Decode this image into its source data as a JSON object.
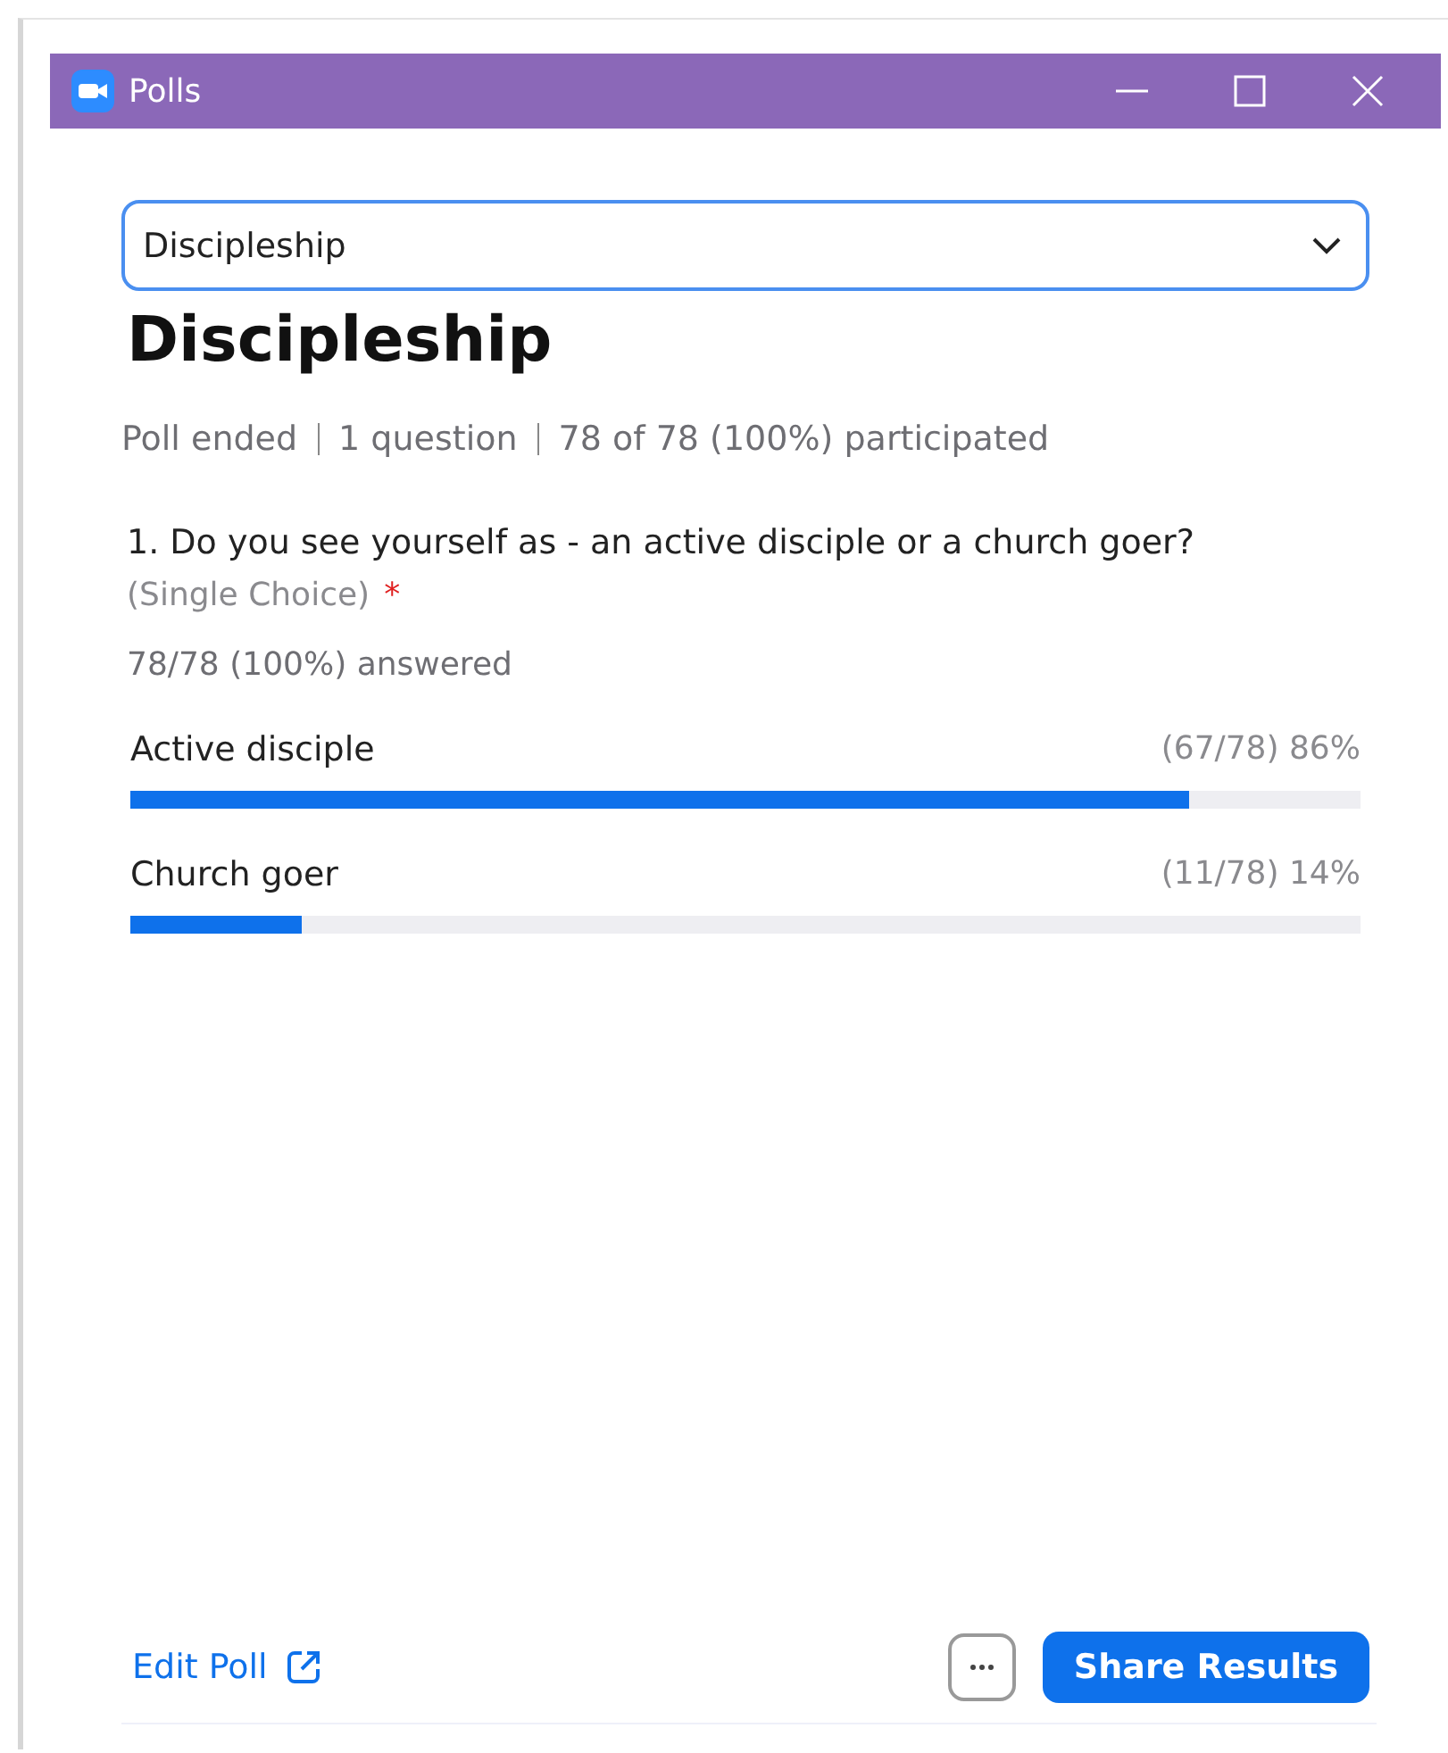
{
  "window": {
    "title": "Polls"
  },
  "poll_selector": {
    "value": "Discipleship"
  },
  "poll_title": "Discipleship",
  "meta": [
    "Poll ended",
    "1 question",
    "78 of 78 (100%) participated"
  ],
  "question": {
    "text": "1. Do you see yourself as - an active disciple or a church goer?",
    "type": "(Single Choice)",
    "required_mark": "*",
    "answered": "78/78 (100%) answered",
    "options": [
      {
        "label": "Active disciple",
        "result": "(67/78) 86%",
        "level": 0.86
      },
      {
        "label": "Church goer",
        "result": "(11/78) 14%",
        "level": 0.14
      }
    ]
  },
  "footer": {
    "edit_link": "Edit Poll",
    "share_button": "Share Results"
  }
}
